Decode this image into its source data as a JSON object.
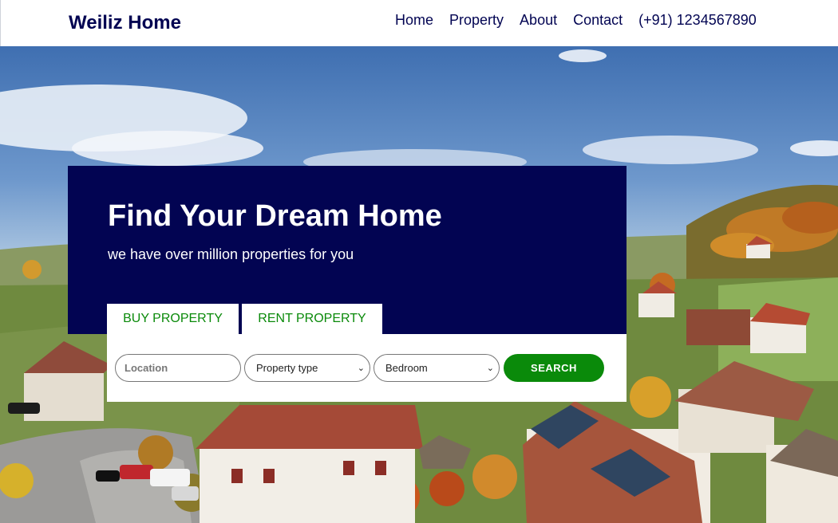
{
  "header": {
    "brand": "Weiliz Home",
    "nav": [
      "Home",
      "Property",
      "About",
      "Contact"
    ],
    "phone": "(+91) 1234567890"
  },
  "hero": {
    "title": "Find Your Dream Home",
    "subtitle": "we have over million properties for you",
    "tabs": [
      "BUY PROPERTY",
      "RENT PROPERTY"
    ],
    "search": {
      "location_placeholder": "Location",
      "property_type": "Property type",
      "bedroom": "Bedroom",
      "button": "SEARCH"
    }
  },
  "colors": {
    "navy": "#020452",
    "green": "#0a8a0a",
    "white": "#ffffff"
  }
}
